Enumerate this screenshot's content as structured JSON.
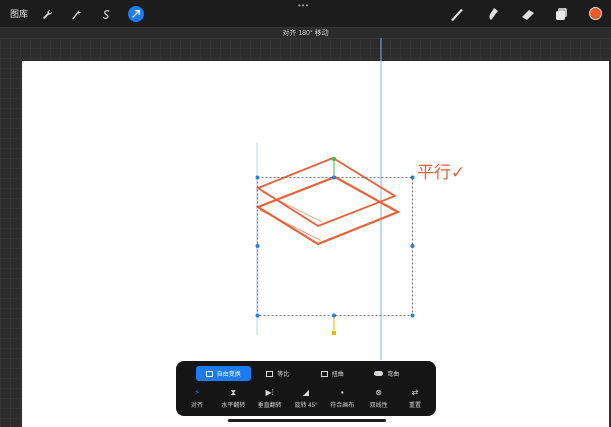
{
  "toolbar": {
    "gallery_label": "图库",
    "left_tools": [
      {
        "name": "actions-wrench-icon",
        "glyph": "🔧"
      },
      {
        "name": "adjustments-wand-icon",
        "glyph": "⁄"
      },
      {
        "name": "selection-s-icon",
        "glyph": "S"
      },
      {
        "name": "transform-arrow-icon",
        "glyph": "↗"
      }
    ],
    "more_glyph": "•••",
    "right_tools": [
      "brush-icon",
      "smudge-icon",
      "eraser-icon",
      "layers-icon"
    ],
    "current_color": "#f0582a"
  },
  "status": {
    "message": "对齐 180° 移动"
  },
  "canvas": {
    "handwritten_note": "平行✓",
    "stroke_color": "#e8613a",
    "guide_color": "#6fa8ea"
  },
  "transform_panel": {
    "modes": [
      {
        "label": "自由变换",
        "active": true
      },
      {
        "label": "等比",
        "active": false
      },
      {
        "label": "扭曲",
        "active": false
      },
      {
        "label": "弯曲",
        "active": false
      }
    ],
    "actions": [
      {
        "label": "对齐",
        "glyph": "⚡",
        "active": true
      },
      {
        "label": "水平翻转",
        "glyph": "⧗",
        "active": false
      },
      {
        "label": "垂直翻转",
        "glyph": "▶⁞",
        "active": false
      },
      {
        "label": "旋转 45°",
        "glyph": "◢",
        "active": false
      },
      {
        "label": "符合画布",
        "glyph": "▪",
        "active": false
      },
      {
        "label": "双线性",
        "glyph": "⊗",
        "active": false
      },
      {
        "label": "重置",
        "glyph": "⇄",
        "active": false
      }
    ]
  }
}
